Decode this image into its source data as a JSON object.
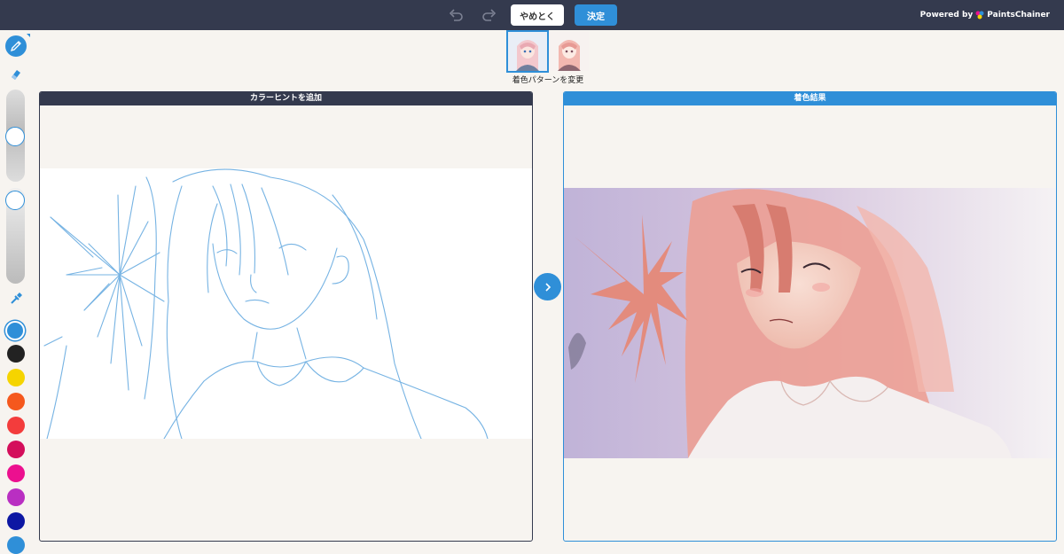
{
  "toolbar": {
    "undo_icon": "undo-icon",
    "redo_icon": "redo-icon",
    "cancel_label": "やめとく",
    "confirm_label": "決定",
    "powered_by": "Powered by",
    "brand": "PaintsChainer"
  },
  "tools": {
    "pencil_icon": "pencil-icon",
    "eraser_icon": "eraser-icon",
    "eyedropper_icon": "eyedropper-icon"
  },
  "palette": {
    "colors": [
      "#2f8fd8",
      "#222222",
      "#f5d400",
      "#f5581d",
      "#f33c3c",
      "#d40e5b",
      "#ec108f",
      "#b92fc2",
      "#0d17a3",
      "#2f8fd8"
    ],
    "selected_index": 0
  },
  "patterns": {
    "label": "着色パターンを変更",
    "selected_index": 0
  },
  "left_panel": {
    "title": "カラーヒントを追加"
  },
  "right_panel": {
    "title": "着色結果"
  },
  "colors": {
    "accent": "#2f8fd8",
    "topbar": "#343a4e",
    "background": "#f7f4f0"
  }
}
